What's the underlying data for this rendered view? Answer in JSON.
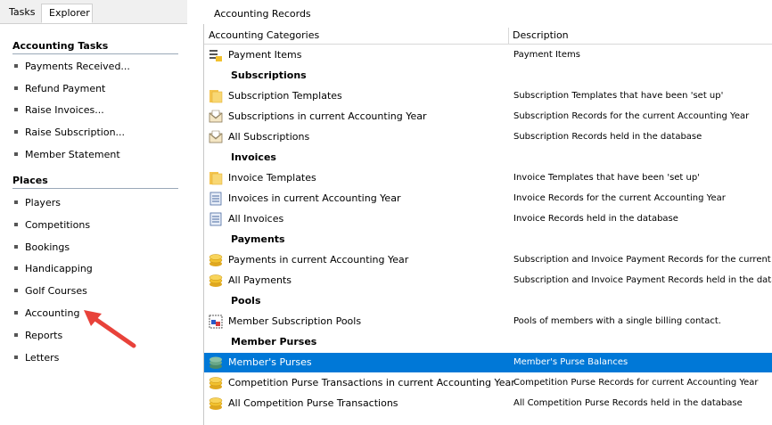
{
  "left_tabs": {
    "tasks": "Tasks",
    "explorer": "Explorer"
  },
  "sections": {
    "accounting_tasks": "Accounting Tasks",
    "places": "Places"
  },
  "task_items": [
    "Payments Received...",
    "Refund Payment",
    "Raise Invoices...",
    "Raise Subscription...",
    "Member Statement"
  ],
  "place_items": [
    "Players",
    "Competitions",
    "Bookings",
    "Handicapping",
    "Golf Courses",
    "Accounting",
    "Reports",
    "Letters"
  ],
  "header": {
    "title": "Accounting Records"
  },
  "columns": {
    "categories": "Accounting Categories",
    "description": "Description"
  },
  "rows": [
    {
      "name": "Payment Items",
      "desc": "Payment Items",
      "icon": "list-icon"
    },
    {
      "name": "Subscriptions",
      "group": true
    },
    {
      "name": "Subscription Templates",
      "desc": "Subscription Templates that have been 'set up'",
      "icon": "folder-icon"
    },
    {
      "name": "Subscriptions in current Accounting Year",
      "desc": "Subscription Records for the current Accounting Year",
      "icon": "envelope-icon"
    },
    {
      "name": "All Subscriptions",
      "desc": "Subscription Records held in the database",
      "icon": "envelope-icon"
    },
    {
      "name": "Invoices",
      "group": true
    },
    {
      "name": "Invoice Templates",
      "desc": "Invoice Templates that have been 'set up'",
      "icon": "folder-icon"
    },
    {
      "name": "Invoices in current Accounting Year",
      "desc": "Invoice Records for the current Accounting Year",
      "icon": "document-icon"
    },
    {
      "name": "All Invoices",
      "desc": "Invoice Records held in the database",
      "icon": "document-icon"
    },
    {
      "name": "Payments",
      "group": true
    },
    {
      "name": "Payments in current Accounting Year",
      "desc": "Subscription and Invoice Payment Records for the current A",
      "icon": "coins-icon"
    },
    {
      "name": "All Payments",
      "desc": "Subscription and Invoice Payment Records held in the datab",
      "icon": "coins-icon"
    },
    {
      "name": "Pools",
      "group": true
    },
    {
      "name": "Member Subscription Pools",
      "desc": "Pools of members with a single billing contact.",
      "icon": "pool-icon"
    },
    {
      "name": "Member Purses",
      "group": true
    },
    {
      "name": "Member's Purses",
      "desc": "Member's Purse Balances",
      "icon": "purse-icon",
      "selected": true
    },
    {
      "name": "Competition Purse Transactions in current Accounting Year",
      "desc": "Competition Purse Records for current Accounting Year",
      "icon": "coins-icon"
    },
    {
      "name": "All Competition Purse Transactions",
      "desc": "All Competition Purse Records held in the database",
      "icon": "coins-icon"
    }
  ],
  "colors": {
    "selection": "#0078d7",
    "arrow": "#e8423a",
    "coin": "#f2c12e",
    "folder": "#f5c550"
  }
}
